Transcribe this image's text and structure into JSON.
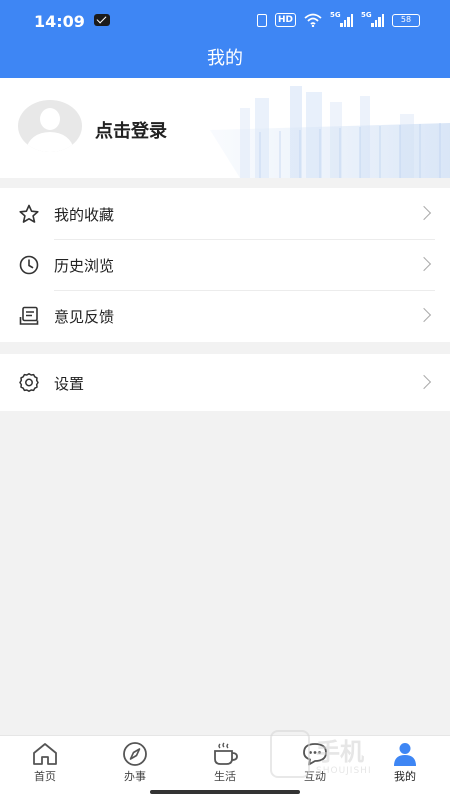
{
  "status_bar": {
    "time": "14:09",
    "hd": "HD",
    "sig1": "5G",
    "sig2": "5G",
    "battery": "58"
  },
  "header": {
    "title": "我的"
  },
  "profile": {
    "login_label": "点击登录"
  },
  "menu_group_1": [
    {
      "label": "我的收藏",
      "icon": "star-icon"
    },
    {
      "label": "历史浏览",
      "icon": "clock-icon"
    },
    {
      "label": "意见反馈",
      "icon": "feedback-icon"
    }
  ],
  "menu_group_2": [
    {
      "label": "设置",
      "icon": "gear-icon"
    }
  ],
  "bottom_nav": [
    {
      "label": "首页",
      "icon": "home-icon"
    },
    {
      "label": "办事",
      "icon": "compass-icon"
    },
    {
      "label": "生活",
      "icon": "coffee-icon"
    },
    {
      "label": "互动",
      "icon": "chat-icon"
    },
    {
      "label": "我的",
      "icon": "user-icon",
      "active": true
    }
  ],
  "watermark": {
    "text": "手机",
    "sub": "SHOUJISHI"
  },
  "colors": {
    "accent": "#3e86f4",
    "background": "#f2f2f2"
  }
}
